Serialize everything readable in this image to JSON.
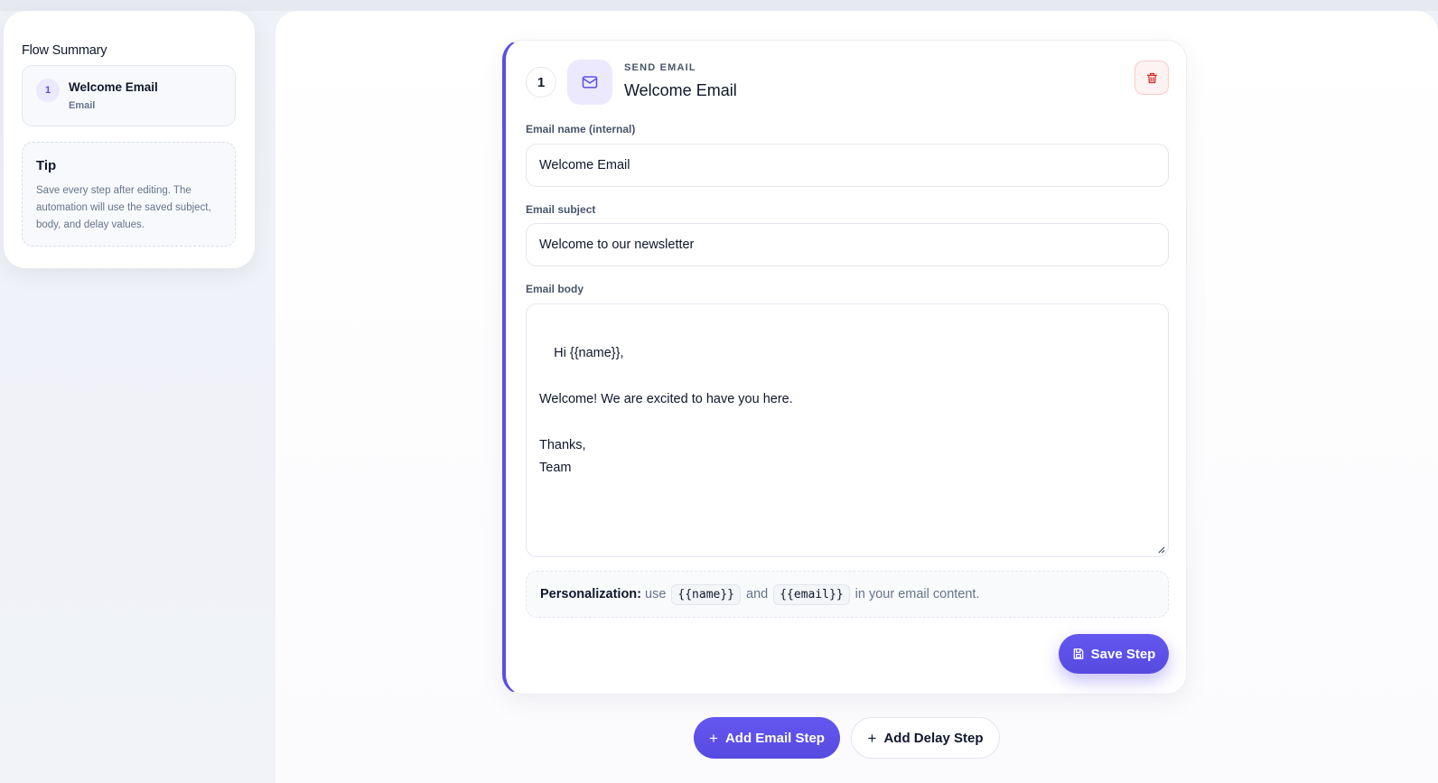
{
  "sidebar": {
    "title": "Flow Summary",
    "items": [
      {
        "number": "1",
        "name": "Welcome Email",
        "type": "Email"
      }
    ],
    "tip": {
      "title": "Tip",
      "text": "Save every step after editing. The automation will use the saved subject, body, and delay values."
    }
  },
  "step": {
    "number": "1",
    "kind": "SEND EMAIL",
    "title": "Welcome Email",
    "icon": "mail-icon",
    "delete_icon": "trash-icon",
    "fields": {
      "name_label": "Email name (internal)",
      "name_value": "Welcome Email",
      "subject_label": "Email subject",
      "subject_value": "Welcome to our newsletter",
      "body_label": "Email body",
      "body_value": "Hi {{name}},\n\nWelcome! We are excited to have you here.\n\nThanks,\nTeam"
    },
    "personalization": {
      "label": "Personalization:",
      "prefix": "use",
      "token_name": "{{name}}",
      "conjunction": "and",
      "token_email": "{{email}}",
      "suffix": "in your email content."
    },
    "save_label": "Save Step"
  },
  "actions": {
    "add_email_label": "Add Email Step",
    "add_delay_label": "Add Delay Step"
  },
  "colors": {
    "accent": "#5b4ee6",
    "danger": "#dc2626"
  }
}
